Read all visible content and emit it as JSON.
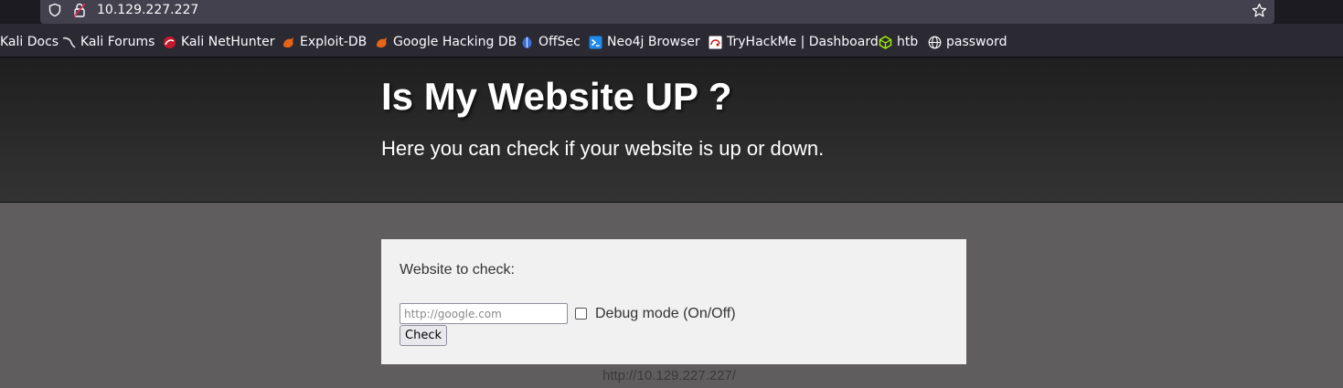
{
  "browser": {
    "url": "10.129.227.227",
    "icons": {
      "left": [
        "shield-icon",
        "lock-icon"
      ],
      "right": [
        "star-icon"
      ]
    }
  },
  "bookmarks": [
    {
      "label": "Kali Docs",
      "icon": "kali-icon"
    },
    {
      "label": "Kali Forums",
      "icon": "kali-icon"
    },
    {
      "label": "Kali NetHunter",
      "icon": "nethunter-icon"
    },
    {
      "label": "Exploit-DB",
      "icon": "exploitdb-icon"
    },
    {
      "label": "Google Hacking DB",
      "icon": "ghdb-icon"
    },
    {
      "label": "OffSec",
      "icon": "offsec-icon"
    },
    {
      "label": "Neo4j Browser",
      "icon": "terminal-icon"
    },
    {
      "label": "TryHackMe | Dashboard",
      "icon": "tryhackme-icon"
    },
    {
      "label": "htb",
      "icon": "htb-cube-icon"
    },
    {
      "label": "password",
      "icon": "globe-icon"
    }
  ],
  "page": {
    "title": "Is My Website UP ?",
    "subtitle": "Here you can check if your website is up or down.",
    "form": {
      "label": "Website to check:",
      "input_placeholder": "http://google.com",
      "input_value": "",
      "debug_label": "Debug mode (On/Off)",
      "debug_checked": false,
      "button_label": "Check"
    },
    "footer_url": "http://10.129.227.227/"
  },
  "colors": {
    "hero_bg": "#262626",
    "page_bg": "#5f5d5e",
    "panel_bg": "#f1f1f1",
    "browser_bar": "#1c1b22",
    "bookmarks_bar": "#2b2a33"
  }
}
